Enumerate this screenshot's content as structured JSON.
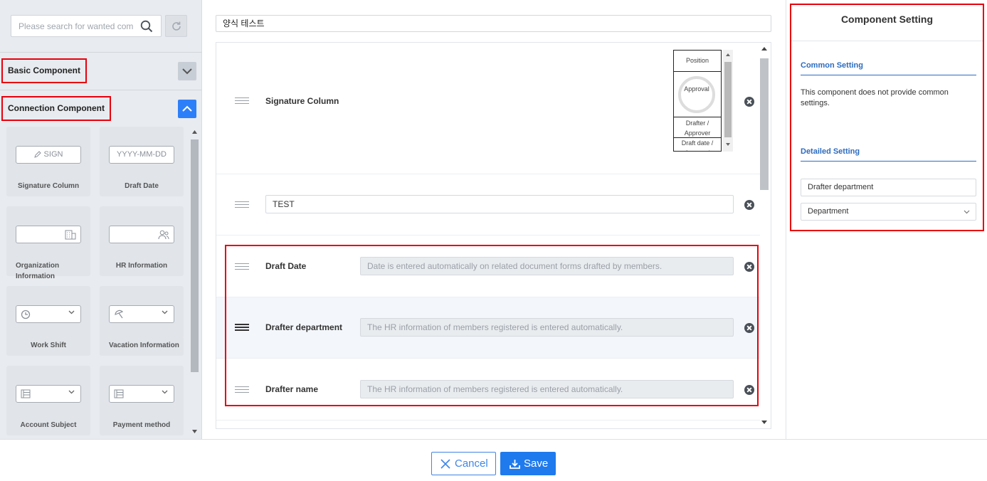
{
  "left": {
    "search_placeholder": "Please search for wanted comp",
    "sections": {
      "basic": "Basic Component",
      "connection": "Connection Component"
    },
    "components": [
      {
        "label": "Signature Column",
        "preview": "SIGN",
        "icon": "pencil-icon"
      },
      {
        "label": "Draft Date",
        "preview": "YYYY-MM-DD",
        "icon": ""
      },
      {
        "label": "Organization Information",
        "preview": "",
        "icon": "building-icon"
      },
      {
        "label": "HR Information",
        "preview": "",
        "icon": "people-icon"
      },
      {
        "label": "Work Shift",
        "preview": "",
        "icon": "clock-icon"
      },
      {
        "label": "Vacation Information",
        "preview": "",
        "icon": "beach-umbrella-icon"
      },
      {
        "label": "Account Subject",
        "preview": "",
        "icon": "list-icon"
      },
      {
        "label": "Payment method",
        "preview": "",
        "icon": "list-icon"
      }
    ]
  },
  "form": {
    "title": "양식 테스트",
    "rows": [
      {
        "label": "Signature Column"
      },
      {
        "value": "TEST"
      },
      {
        "label": "Draft Date",
        "placeholder": "Date is entered automatically on related document forms drafted by members."
      },
      {
        "label": "Drafter department",
        "placeholder": "The HR information of members registered is entered automatically."
      },
      {
        "label": "Drafter name",
        "placeholder": "The HR information of members registered is entered automatically."
      }
    ],
    "signature_preview": {
      "position": "Position",
      "stamp": "Approval",
      "role": "Drafter / Approver",
      "date": "Draft date / Approval"
    }
  },
  "settings": {
    "title": "Component Setting",
    "common_heading": "Common Setting",
    "common_text": "This component does not provide common settings.",
    "detailed_heading": "Detailed Setting",
    "label_value": "Drafter department",
    "select_value": "Department"
  },
  "footer": {
    "cancel": "Cancel",
    "save": "Save"
  },
  "colors": {
    "accent": "#1f7aee",
    "highlight": "#e8000c",
    "heading_blue": "#2d6cc0"
  }
}
